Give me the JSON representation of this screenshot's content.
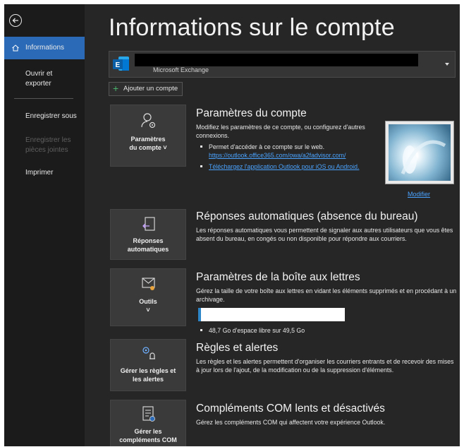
{
  "sidebar": {
    "items": [
      {
        "label": "Informations"
      },
      {
        "label": "Ouvrir et exporter"
      },
      {
        "label": "Enregistrer sous"
      },
      {
        "label": "Enregistrer les pièces jointes"
      },
      {
        "label": "Imprimer"
      }
    ]
  },
  "page_title": "Informations sur le compte",
  "account": {
    "type": "Microsoft Exchange"
  },
  "add_account_label": "Ajouter un compte",
  "sections": {
    "account_settings": {
      "tile_label_1": "Paramètres",
      "tile_label_2": "du compte ˅",
      "title": "Paramètres du compte",
      "desc": "Modifiez les paramètres de ce compte, ou configurez d'autres connexions.",
      "bullet1": "Permet d'accéder à ce compte sur le web.",
      "bullet1_link": "https://outlook.office365.com/owa/a2fadvisor.com/",
      "bullet2_link": "Téléchargez l'application Outlook pour iOS ou Android."
    },
    "auto_replies": {
      "tile_label_1": "Réponses",
      "tile_label_2": "automatiques",
      "title": "Réponses automatiques (absence du bureau)",
      "desc": "Les réponses automatiques vous permettent de signaler aux autres utilisateurs que vous êtes absent du bureau, en congés ou non disponible pour répondre aux courriers."
    },
    "mailbox": {
      "tile_label_1": "Outils",
      "tile_label_2": "˅",
      "title": "Paramètres de la boîte aux lettres",
      "desc": "Gérez la taille de votre boîte aux lettres en vidant les éléments supprimés et en procédant à un archivage.",
      "usage_fraction": 0.02,
      "free_space": "48,7 Go d'espace libre sur 49,5 Go"
    },
    "rules": {
      "tile_label_1": "Gérer les règles et",
      "tile_label_2": "les alertes",
      "title": "Règles et alertes",
      "desc": "Les règles et les alertes permettent d'organiser les courriers entrants et de recevoir des mises à jour lors de l'ajout, de la modification ou de la suppression d'éléments."
    },
    "com_addins": {
      "tile_label_1": "Gérer les",
      "tile_label_2": "compléments COM",
      "title": "Compléments COM lents et désactivés",
      "desc": "Gérez les compléments COM qui affectent votre expérience Outlook."
    }
  },
  "photo_modify_label": "Modifier",
  "colors": {
    "accent": "#2b6ab6",
    "link": "#4aa3ff",
    "background": "#262626",
    "sidebar": "#1b1b1b"
  }
}
